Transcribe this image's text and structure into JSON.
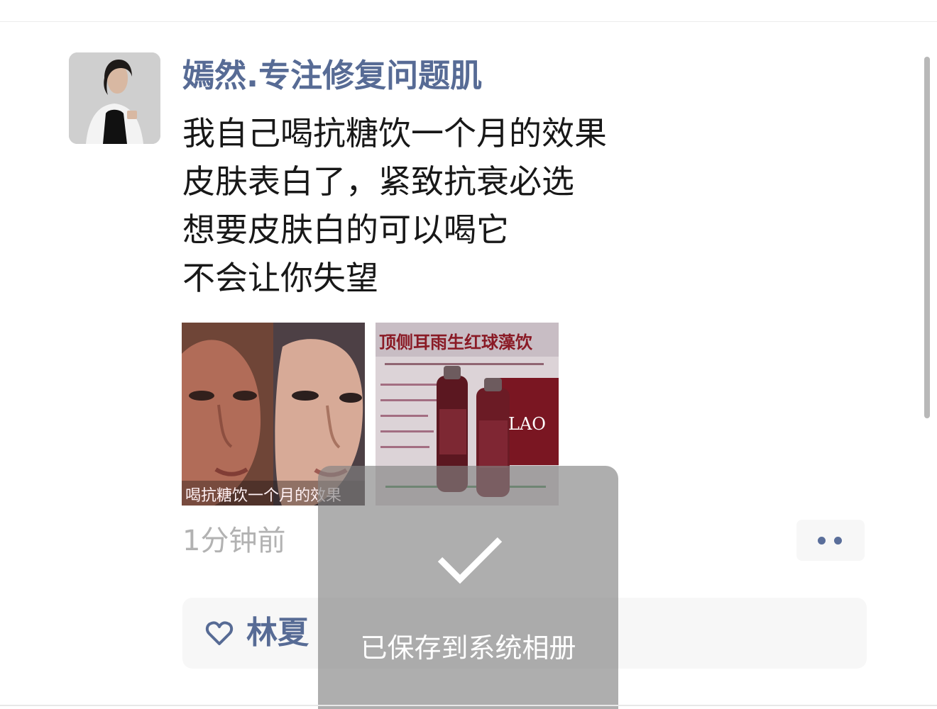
{
  "post": {
    "author": "嫣然.专注修复问题肌",
    "lines": [
      "我自己喝抗糖饮一个月的效果",
      "皮肤表白了，紧致抗衰必选",
      "想要皮肤白的可以喝它",
      "不会让你失望"
    ],
    "images": [
      {
        "caption": "喝抗糖饮一个月的效果"
      },
      {
        "headline": "顶侧耳雨生红球藻饮",
        "product_text": "LAO"
      }
    ],
    "time": "1分钟前",
    "more_icon": "more-dots-icon",
    "likes": {
      "icon": "heart-outline-icon",
      "names": "林夏"
    }
  },
  "toast": {
    "icon": "checkmark-icon",
    "message": "已保存到系统相册"
  },
  "colors": {
    "link": "#576b95",
    "text": "#181818",
    "time": "#b2b2b2",
    "panel": "#f7f7f7",
    "toast": "#828282"
  }
}
